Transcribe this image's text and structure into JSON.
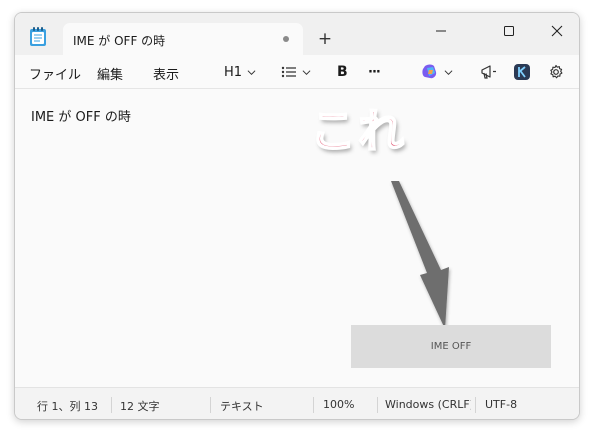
{
  "window": {
    "tab_title": "IME が OFF の時",
    "new_tab_label": "+"
  },
  "menu": {
    "file": "ファイル",
    "edit": "編集",
    "view": "表示"
  },
  "toolbar": {
    "heading": "H1",
    "bold": "B",
    "more": "···"
  },
  "editor": {
    "text": "IME が OFF の時"
  },
  "callout": {
    "text": "これ"
  },
  "ime_indicator": {
    "label": "IME OFF"
  },
  "status": {
    "position": "行 1、列 13",
    "chars": "12 文字",
    "format": "テキスト",
    "zoom": "100%",
    "line_ending": "Windows (CRLF)",
    "encoding": "UTF-8"
  },
  "colors": {
    "callout": "#e0506c",
    "arrow": "#6e6e6e",
    "indicator_bg": "#dcdcdc",
    "copilot_accent": "#7a5cf0"
  }
}
